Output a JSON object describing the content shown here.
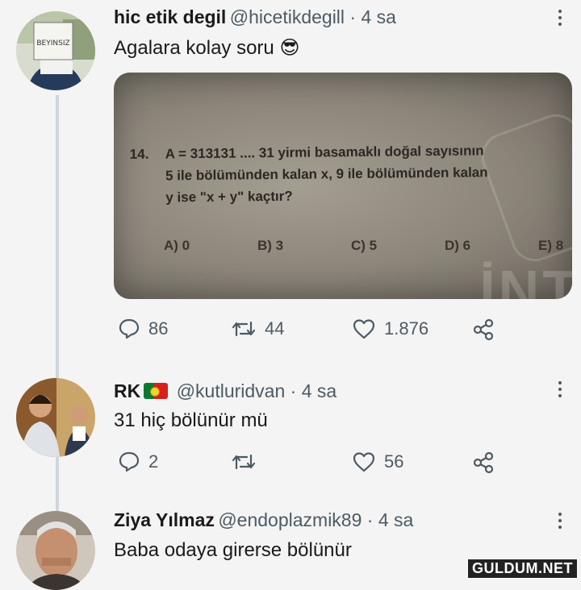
{
  "tweets": [
    {
      "name": "hic etik degil",
      "handle": "@hicetikdegill · 4 sa",
      "text": "Agalara kolay soru 😎",
      "avatar_sign": "BEYINSIZ",
      "actions": {
        "replies": "86",
        "retweets": "44",
        "likes": "1.876"
      }
    },
    {
      "name": "RK",
      "handle": "@kutluridvan · 4 sa",
      "text": "31 hiç bölünür mü",
      "actions": {
        "replies": "2",
        "retweets": "",
        "likes": "56"
      }
    },
    {
      "name": "Ziya Yılmaz",
      "handle": "@endoplazmik89 · 4 sa",
      "text": "Baba odaya girerse bölünür"
    }
  ],
  "question": {
    "number": "14.",
    "line1": "A = 313131 .... 31 yirmi basamaklı doğal sayısının",
    "line2": "5 ile bölümünden kalan x, 9 ile bölümünden kalan",
    "line3": "y ise \"x + y\" kaçtır?",
    "options": [
      "A) 0",
      "B) 3",
      "C) 5",
      "D) 6",
      "E) 8"
    ],
    "stamp": "İNT"
  },
  "watermark": "GULDUM.NET"
}
